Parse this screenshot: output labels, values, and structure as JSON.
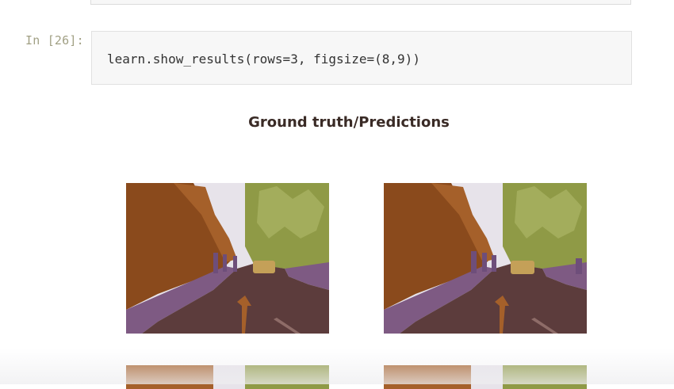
{
  "cell": {
    "prompt": "In [26]:",
    "code": "learn.show_results(rows=3, figsize=(8,9))"
  },
  "output": {
    "title": "Ground truth/Predictions",
    "panels": [
      "ground-truth-1",
      "prediction-1",
      "ground-truth-2",
      "prediction-2"
    ]
  },
  "colors": {
    "building": "#8a4a1c",
    "sidewalk": "#7e5a83",
    "road": "#5c3c3c",
    "tree": "#8f9a46",
    "sky": "#e7e3ea",
    "car": "#c4a058"
  }
}
